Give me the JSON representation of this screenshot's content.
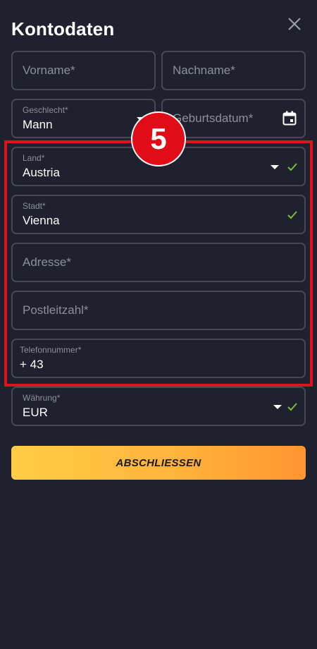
{
  "header": {
    "title": "Kontodaten",
    "close_icon": "close-icon"
  },
  "form": {
    "vorname": {
      "placeholder": "Vorname*"
    },
    "nachname": {
      "placeholder": "Nachname*"
    },
    "geschlecht": {
      "label": "Geschlecht*",
      "value": "Mann"
    },
    "geburtsdatum": {
      "placeholder": "Geburtsdatum*",
      "icon": "calendar-icon"
    },
    "land": {
      "label": "Land*",
      "value": "Austria",
      "valid": true
    },
    "stadt": {
      "label": "Stadt*",
      "value": "Vienna",
      "valid": true
    },
    "adresse": {
      "placeholder": "Adresse*"
    },
    "postleitzahl": {
      "placeholder": "Postleitzahl*"
    },
    "telefon": {
      "label": "Telefonnummer*",
      "value": "+ 43"
    },
    "waehrung": {
      "label": "Währung*",
      "value": "EUR",
      "valid": true
    }
  },
  "annotation": {
    "step_number": "5"
  },
  "submit": {
    "label": "ABSCHLIESSEN"
  },
  "colors": {
    "background": "#1f222e",
    "field_border": "#454a58",
    "check_green": "#7fb83a",
    "highlight_red": "#e0121b",
    "button_gradient_start": "#ffcd45",
    "button_gradient_end": "#ff9530"
  }
}
